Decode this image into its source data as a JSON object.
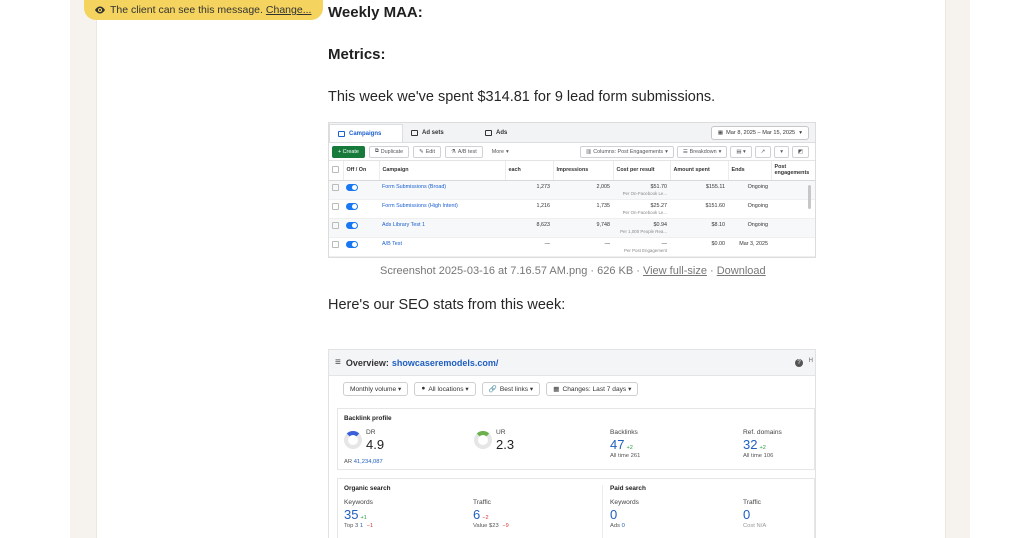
{
  "client_banner": {
    "text": "The client can see this message.",
    "link": "Change..."
  },
  "post": {
    "heading_weekly": "Weekly MAA:",
    "heading_metrics": "Metrics:",
    "spent_text": "This week we've spent $314.81 for 9 lead form submissions.",
    "seo_intro": "Here's our SEO stats from this week:"
  },
  "ads_screenshot": {
    "tabs": [
      "Campaigns",
      "Ad sets",
      "Ads"
    ],
    "date_range": "Mar 8, 2025 – Mar 15, 2025",
    "toolbar": {
      "create": "+ Create",
      "duplicate": "Duplicate",
      "edit": "Edit",
      "ab_test": "A/B test",
      "more": "More",
      "columns": "Columns: Post Engagements",
      "breakdown": "Breakdown"
    },
    "headers": [
      "Off / On",
      "Campaign",
      "each",
      "Impressions",
      "Cost per result",
      "Amount spent",
      "Ends",
      "Post engagements"
    ],
    "rows": [
      {
        "campaign": "Form Submissions (Broad)",
        "reach": "1,273",
        "impressions": "2,005",
        "cost": "$51.70",
        "cost_sub": "Per On-Facebook Le...",
        "spent": "$155.11",
        "ends": "Ongoing"
      },
      {
        "campaign": "Form Submissions (High Intent)",
        "reach": "1,216",
        "impressions": "1,735",
        "cost": "$25.27",
        "cost_sub": "Per On-Facebook Le...",
        "spent": "$151.60",
        "ends": "Ongoing"
      },
      {
        "campaign": "Ads Library Test 1",
        "reach": "8,623",
        "impressions": "9,748",
        "cost": "$0.94",
        "cost_sub": "Per 1,000 People Rea...",
        "spent": "$8.10",
        "ends": "Ongoing"
      },
      {
        "campaign": "A/B Test",
        "reach": "—",
        "impressions": "—",
        "cost": "—",
        "cost_sub": "Per Post Engagement",
        "spent": "$0.00",
        "ends": "Mar 3, 2025"
      }
    ]
  },
  "caption": {
    "filename": "Screenshot 2025-03-16 at 7.16.57 AM.png · 626 KB · ",
    "view_full": "View full-size",
    "sep": " · ",
    "download": "Download"
  },
  "seo_screenshot": {
    "title_prefix": "Overview:",
    "domain": "showcaseremodels.com/",
    "help_label": "H",
    "filters": [
      "Monthly volume ▾",
      "All locations ▾",
      "Best links ▾",
      "Changes: Last 7 days ▾"
    ],
    "backlink_profile": {
      "title": "Backlink profile",
      "dr": {
        "label": "DR",
        "value": "4.9",
        "ar_label": "AR",
        "ar_value": "41,234,087"
      },
      "ur": {
        "label": "UR",
        "value": "2.3"
      },
      "backlinks": {
        "label": "Backlinks",
        "value": "47",
        "delta": "+2",
        "sub": "All time 261"
      },
      "ref_domains": {
        "label": "Ref. domains",
        "value": "32",
        "delta": "+2",
        "sub": "All time 106"
      }
    },
    "organic_search": {
      "title": "Organic search",
      "keywords": {
        "label": "Keywords",
        "value": "35",
        "delta": "+1",
        "sub_label": "Top 3",
        "sub_value": "1",
        "sub_delta": "−1"
      },
      "traffic": {
        "label": "Traffic",
        "value": "6",
        "delta": "−2",
        "sub_label": "Value",
        "sub_value": "$23",
        "sub_delta": "−9"
      }
    },
    "paid_search": {
      "title": "Paid search",
      "keywords": {
        "label": "Keywords",
        "value": "0",
        "sub_label": "Ads",
        "sub_value": "0"
      },
      "traffic": {
        "label": "Traffic",
        "value": "0",
        "sub": "Cost N/A"
      }
    }
  }
}
